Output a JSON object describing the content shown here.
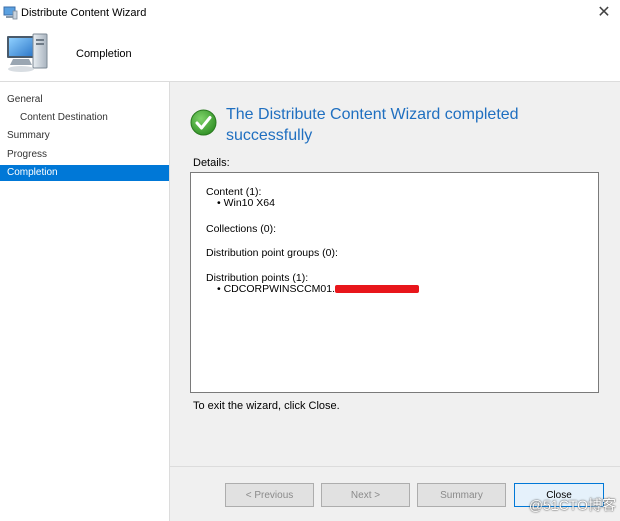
{
  "window": {
    "title": "Distribute Content Wizard",
    "close_glyph": "✕"
  },
  "header": {
    "step_title": "Completion",
    "icon": "computer-icon"
  },
  "sidebar": {
    "items": [
      {
        "label": "General",
        "active": false,
        "indent": 0
      },
      {
        "label": "Content Destination",
        "active": false,
        "indent": 1
      },
      {
        "label": "Summary",
        "active": false,
        "indent": 0
      },
      {
        "label": "Progress",
        "active": false,
        "indent": 0
      },
      {
        "label": "Completion",
        "active": true,
        "indent": 0
      }
    ]
  },
  "main": {
    "success_line1": "The Distribute Content Wizard completed",
    "success_line2": "successfully",
    "details_label": "Details:",
    "details": {
      "content_header": "Content (1):",
      "content_item": "Win10 X64",
      "collections": "Collections (0):",
      "dp_groups": "Distribution point groups (0):",
      "dp_header": "Distribution points (1):",
      "dp_item": "CDCORPWINSCCM01."
    },
    "exit_text": "To exit the wizard, click Close."
  },
  "footer": {
    "previous_label": "< Previous",
    "next_label": "Next >",
    "summary_label": "Summary",
    "close_label": "Close"
  },
  "watermark": "@51CTO博客",
  "colors": {
    "accent": "#0078d7",
    "success_title": "#1f6fc0",
    "redaction": "#e8161b"
  }
}
